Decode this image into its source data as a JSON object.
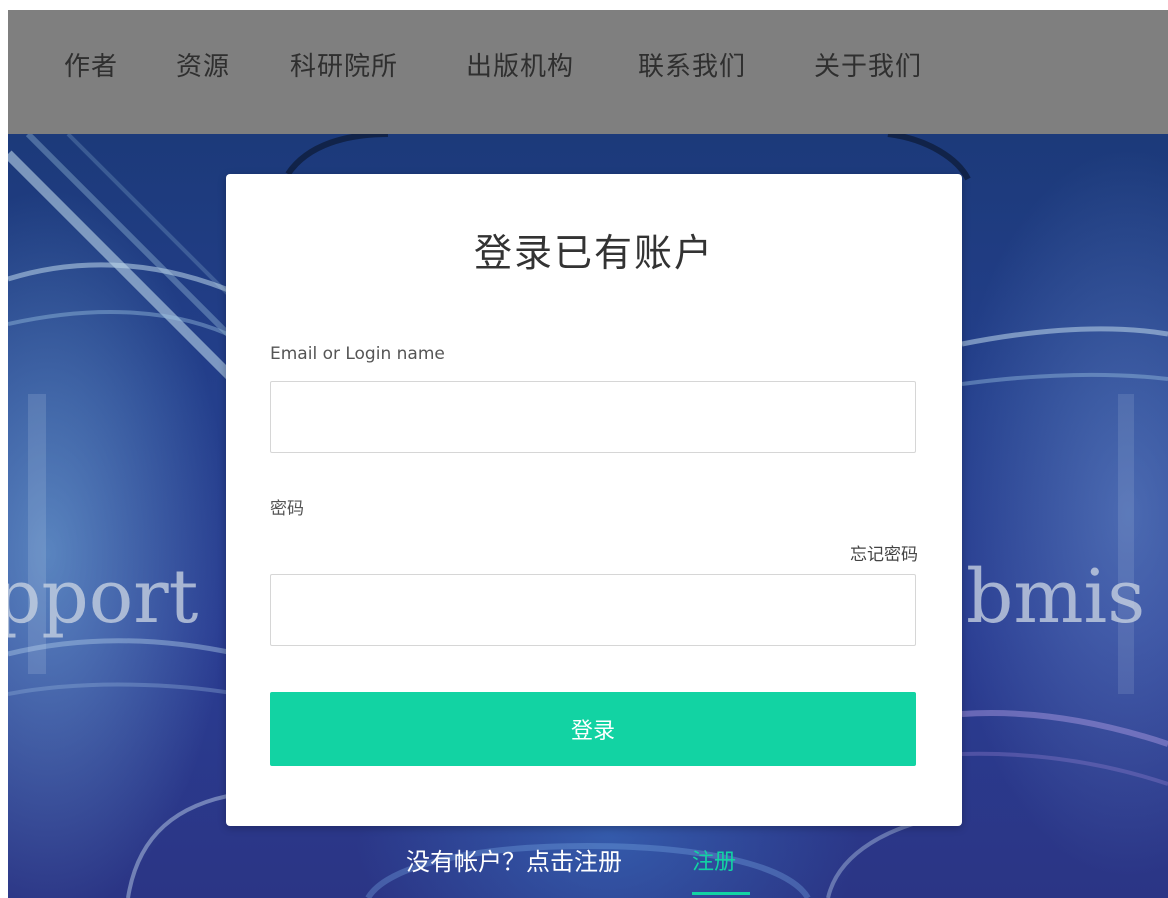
{
  "nav": {
    "items": [
      {
        "label": "作者"
      },
      {
        "label": "资源"
      },
      {
        "label": "科研院所"
      },
      {
        "label": "出版机构"
      },
      {
        "label": "联系我们"
      },
      {
        "label": "关于我们"
      }
    ]
  },
  "hero": {
    "left_text": "pport",
    "right_text": "bmis"
  },
  "login": {
    "title": "登录已有账户",
    "email_label": "Email or Login name",
    "email_value": "",
    "password_label": "密码",
    "password_value": "",
    "forgot_label": "忘记密码",
    "submit_label": "登录"
  },
  "register": {
    "prompt": "没有帐户？点击注册",
    "link_label": "注册"
  },
  "colors": {
    "nav_bg": "#7f7f7f",
    "accent": "#12d3a3",
    "hero_bg": "#243f8c"
  }
}
